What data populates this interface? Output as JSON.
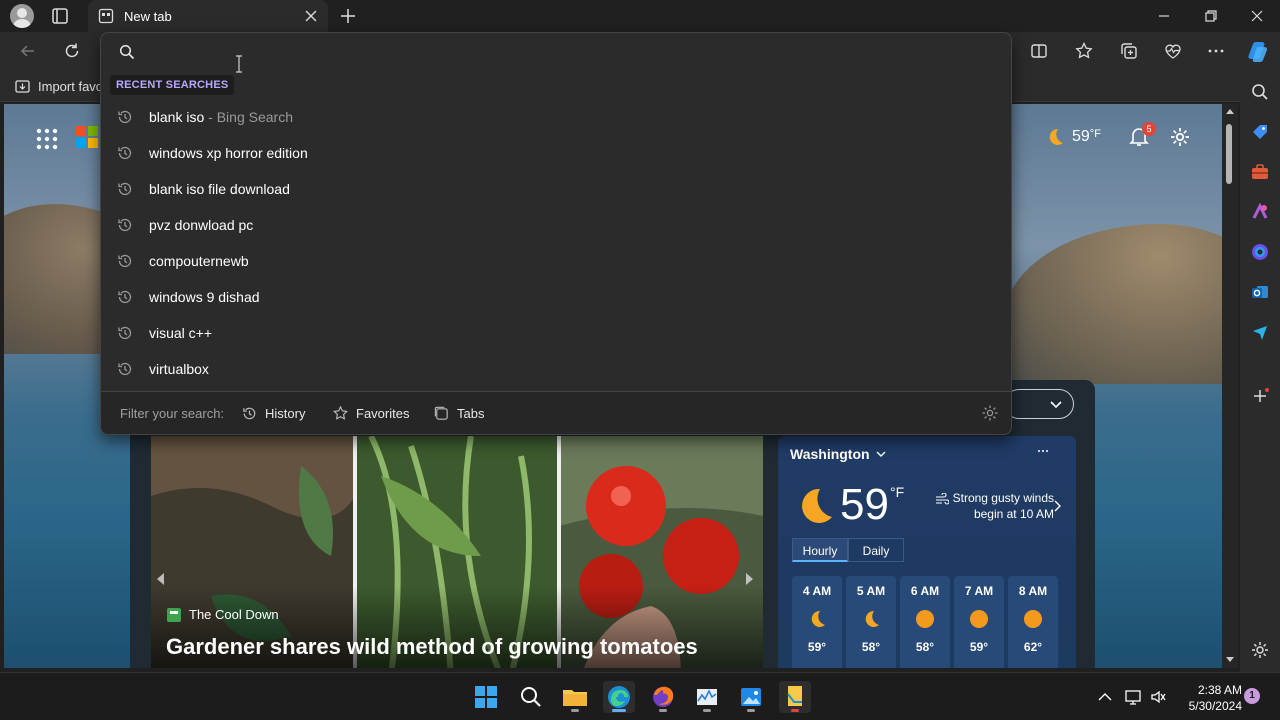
{
  "window": {
    "tab_title": "New tab",
    "window_controls": [
      "minimize",
      "restore",
      "close"
    ]
  },
  "favorites_bar": {
    "import_label": "Import favo"
  },
  "ntp": {
    "weather_temp": "59",
    "weather_unit": "°F",
    "notifications_count": "5"
  },
  "news": {
    "source": "The Cool Down",
    "headline": "Gardener shares wild method of growing tomatoes"
  },
  "weather_card": {
    "location": "Washington",
    "temp": "59",
    "unit": "°F",
    "alert_line1": "Strong gusty winds",
    "alert_line2": "begin at 10 AM",
    "tabs": [
      "Hourly",
      "Daily"
    ],
    "hours": [
      {
        "time": "4 AM",
        "icon": "moon-icon",
        "temp": "59°"
      },
      {
        "time": "5 AM",
        "icon": "moon-icon",
        "temp": "58°"
      },
      {
        "time": "6 AM",
        "icon": "sun-icon",
        "temp": "58°"
      },
      {
        "time": "7 AM",
        "icon": "sun-icon",
        "temp": "59°"
      },
      {
        "time": "8 AM",
        "icon": "sun-icon",
        "temp": "62°"
      }
    ]
  },
  "search_dropdown": {
    "input_value": "",
    "section_label": "RECENT SEARCHES",
    "suggestions": [
      {
        "text": "blank iso",
        "suffix": " - Bing Search"
      },
      {
        "text": "windows xp horror edition",
        "suffix": ""
      },
      {
        "text": "blank iso file download",
        "suffix": ""
      },
      {
        "text": "pvz donwload pc",
        "suffix": ""
      },
      {
        "text": "compouternewb",
        "suffix": ""
      },
      {
        "text": "windows 9 dishad",
        "suffix": ""
      },
      {
        "text": "visual c++",
        "suffix": ""
      },
      {
        "text": "virtualbox",
        "suffix": ""
      }
    ],
    "filter_label": "Filter your search:",
    "filters": [
      "History",
      "Favorites",
      "Tabs"
    ]
  },
  "taskbar": {
    "time": "2:38 AM",
    "date": "5/30/2024",
    "notification_count": "1"
  },
  "colors": {
    "accent": "#b9a8ff",
    "taskbar_active": "#60b0ff",
    "badge": "#e0463a"
  }
}
